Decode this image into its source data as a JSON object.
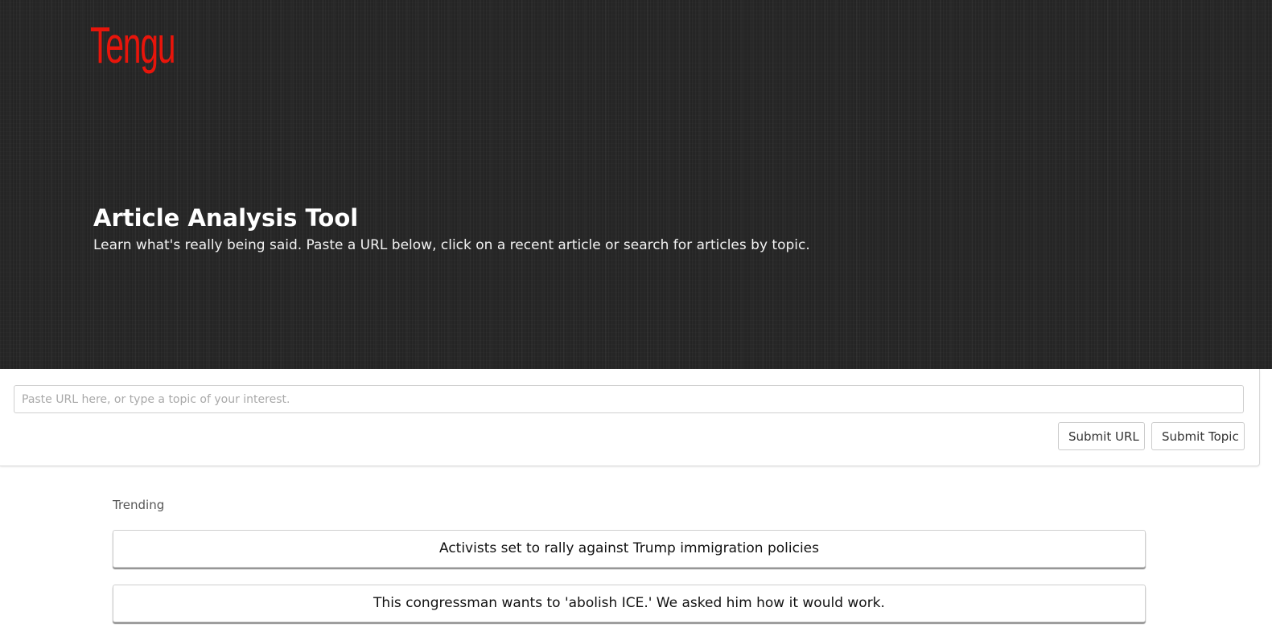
{
  "brand": {
    "logo_text": "Tengu",
    "logo_color": "#e8150b"
  },
  "hero": {
    "title": "Article Analysis Tool",
    "subtitle": "Learn what's really being said. Paste a URL below, click on a recent article or search for articles by topic."
  },
  "search": {
    "value": "",
    "placeholder": "Paste URL here, or type a topic of your interest.",
    "submit_url_label": "Submit URL",
    "submit_topic_label": "Submit Topic"
  },
  "trending": {
    "label": "Trending",
    "articles": [
      {
        "title": "Activists set to rally against Trump immigration policies"
      },
      {
        "title": "This congressman wants to 'abolish ICE.' We asked him how it would work."
      }
    ]
  }
}
